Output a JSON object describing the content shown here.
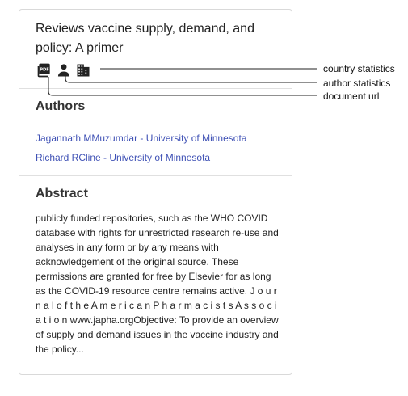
{
  "card": {
    "title": "Reviews vaccine supply, demand, and policy: A primer",
    "icons": [
      {
        "name": "pdf-icon",
        "target": "document url"
      },
      {
        "name": "person-icon",
        "target": "author statistics"
      },
      {
        "name": "building-icon",
        "target": "country statistics"
      }
    ],
    "authors_heading": "Authors",
    "authors": [
      "Jagannath MMuzumdar - University of Minnesota",
      "Richard RCline - University of Minnesota"
    ],
    "abstract_heading": "Abstract",
    "abstract": "publicly funded repositories, such as the WHO COVID database with rights for unrestricted research re-use and analyses in any form or by any means with acknowledgement of the original source. These permissions are granted for free by Elsevier for as long as the COVID-19 resource centre remains active. J o u r n a l o f t h e A m e r i c a n P h a r m a c i s t s A s s o c i a t i o n www.japha.orgObjective: To provide an overview of supply and demand issues in the vaccine industry and the policy..."
  },
  "callouts": {
    "country": "country statistics",
    "author": "author statistics",
    "document": "document url"
  },
  "colors": {
    "link": "#3f51b5",
    "border": "#d9d9d9",
    "icon": "#222222"
  }
}
